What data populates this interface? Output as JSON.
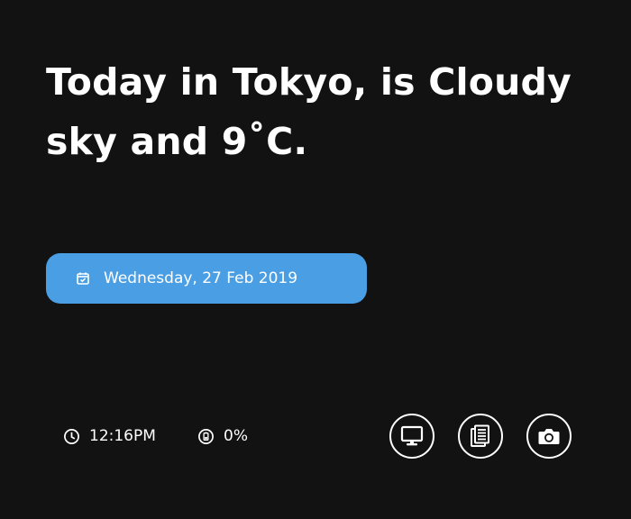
{
  "headline": {
    "line1": "Today in Tokyo, is Cloudy",
    "line2": "sky and 9˚C."
  },
  "date_pill": {
    "icon": "calendar-check-icon",
    "label": "Wednesday, 27 Feb 2019",
    "color": "#4a9ee4"
  },
  "status": {
    "time": "12:16PM",
    "time_icon": "clock-icon",
    "battery": "0%",
    "battery_icon": "battery-icon"
  },
  "actions": [
    {
      "name": "monitor",
      "icon": "monitor-icon"
    },
    {
      "name": "notes",
      "icon": "document-icon"
    },
    {
      "name": "camera",
      "icon": "camera-icon"
    }
  ],
  "colors": {
    "background": "#121212",
    "accent": "#4a9ee4",
    "text": "#ffffff"
  }
}
